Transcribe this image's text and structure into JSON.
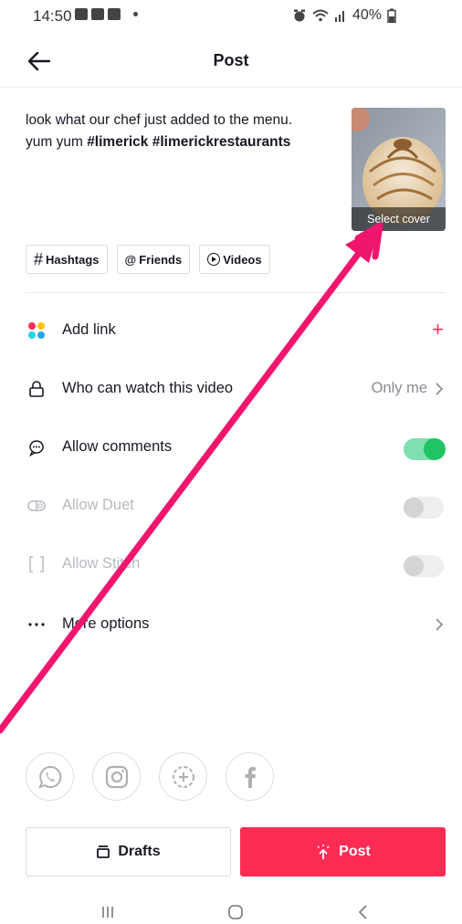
{
  "status_bar": {
    "time": "14:50",
    "battery": "40%"
  },
  "header": {
    "title": "Post"
  },
  "caption": {
    "line1": "look what our chef just added to the menu.",
    "line2_plain": "yum yum ",
    "tag1": "#limerick",
    "tag2": "#limerickrestaurants"
  },
  "cover": {
    "label": "Select cover"
  },
  "chips": {
    "hashtags": "Hashtags",
    "friends": "Friends",
    "videos": "Videos"
  },
  "settings": {
    "add_link": "Add link",
    "who_can_watch": "Who can watch this video",
    "who_can_watch_value": "Only me",
    "allow_comments": "Allow comments",
    "allow_duet": "Allow Duet",
    "allow_stitch": "Allow Stitch",
    "more_options": "More options"
  },
  "toggles": {
    "allow_comments": true,
    "allow_duet": false,
    "allow_stitch": false
  },
  "share_icons": [
    "whatsapp-icon",
    "instagram-icon",
    "add-circle-icon",
    "facebook-icon"
  ],
  "buttons": {
    "drafts": "Drafts",
    "post": "Post"
  },
  "colors": {
    "accent": "#fe2c55",
    "toggle_on": "#20c464",
    "annotation_arrow": "#f0166e"
  }
}
